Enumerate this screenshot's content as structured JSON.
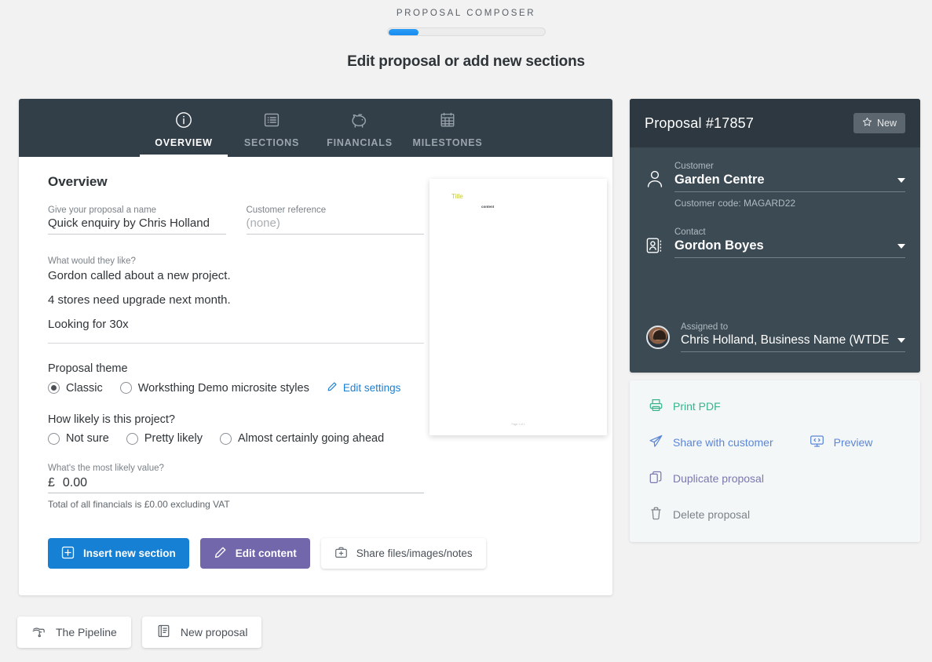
{
  "header": {
    "app_title": "PROPOSAL COMPOSER",
    "progress_percent": "12",
    "page_heading": "Edit proposal or add new sections"
  },
  "tabs": [
    {
      "label": "OVERVIEW",
      "icon": "info-circle-icon",
      "active": true
    },
    {
      "label": "SECTIONS",
      "icon": "list-box-icon",
      "active": false
    },
    {
      "label": "FINANCIALS",
      "icon": "piggy-bank-icon",
      "active": false
    },
    {
      "label": "MILESTONES",
      "icon": "calendar-grid-icon",
      "active": false
    }
  ],
  "overview": {
    "section_title": "Overview",
    "name_label": "Give your proposal a name",
    "name_value": "Quick enquiry by Chris Holland",
    "reference_label": "Customer reference",
    "reference_placeholder": "(none)",
    "wants_label": "What would they like?",
    "wants_lines": [
      "Gordon called about a new project.",
      "4 stores need upgrade next month.",
      "Looking for 30x"
    ],
    "theme_title": "Proposal theme",
    "theme_options": [
      {
        "label": "Classic",
        "selected": true
      },
      {
        "label": "Worksthing Demo microsite styles",
        "selected": false
      }
    ],
    "edit_settings_label": "Edit settings",
    "likelihood_title": "How likely is this project?",
    "likelihood_options": [
      {
        "label": "Not sure",
        "selected": false
      },
      {
        "label": "Pretty likely",
        "selected": false
      },
      {
        "label": "Almost certainly going ahead",
        "selected": false
      }
    ],
    "value_label": "What's the most likely value?",
    "currency_symbol": "£",
    "value_amount": "0.00",
    "total_note": "Total of all financials is £0.00 excluding VAT"
  },
  "doc_preview": {
    "title": "Title",
    "content": "content",
    "footer": "Page 1 of 1"
  },
  "buttons": {
    "insert_section": "Insert new section",
    "edit_content": "Edit content",
    "share_files": "Share files/images/notes"
  },
  "sidebar": {
    "title": "Proposal #17857",
    "badge": "New",
    "customer_label": "Customer",
    "customer_value": "Garden Centre",
    "customer_code": "Customer code: MAGARD22",
    "contact_label": "Contact",
    "contact_value": "Gordon Boyes",
    "assigned_label": "Assigned to",
    "assigned_value": "Chris Holland, Business Name (WTDE"
  },
  "actions": {
    "print_pdf": "Print PDF",
    "share_with_customer": "Share with customer",
    "preview": "Preview",
    "duplicate": "Duplicate proposal",
    "delete": "Delete proposal"
  },
  "bottom": {
    "pipeline": "The Pipeline",
    "new_proposal": "New proposal"
  },
  "colors": {
    "accent_blue": "#1680d4",
    "purple": "#7267ab",
    "sidebar_bg": "#3b4a53",
    "sidebar_head": "#2d3840",
    "tabbar": "#323e48",
    "green": "#35b58c"
  }
}
